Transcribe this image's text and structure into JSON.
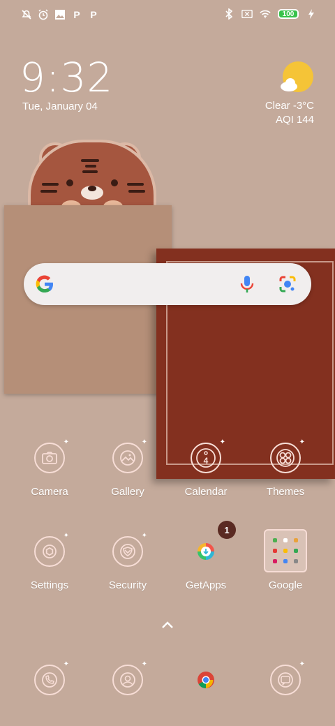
{
  "status_bar": {
    "left_icons": [
      "alarm-off-icon",
      "alarm-clock-icon",
      "photo-icon",
      "p-icon",
      "p-icon"
    ],
    "right_icons": [
      "bluetooth-icon",
      "sim-off-icon",
      "wifi-icon"
    ],
    "battery": "100"
  },
  "clock": {
    "time": "9:32",
    "date": "Tue, January 04"
  },
  "weather": {
    "condition": "Clear  -3°C",
    "aqi": "AQI 144"
  },
  "search": {
    "icons": [
      "google-g-icon",
      "microphone-icon",
      "lens-icon"
    ]
  },
  "apps_row1": [
    {
      "label": "Camera"
    },
    {
      "label": "Gallery"
    },
    {
      "label": "Calendar",
      "icon_text": "4"
    },
    {
      "label": "Themes"
    }
  ],
  "apps_row2": [
    {
      "label": "Settings"
    },
    {
      "label": "Security"
    },
    {
      "label": "GetApps",
      "badge": "1"
    },
    {
      "label": "Google"
    }
  ],
  "dock": [
    "phone-icon",
    "contacts-icon",
    "chrome-icon",
    "messages-icon"
  ],
  "colors": {
    "wallpaper": "#c4aa9b",
    "accent_red": "#83301f",
    "icon_stroke": "#f7ddd6"
  }
}
